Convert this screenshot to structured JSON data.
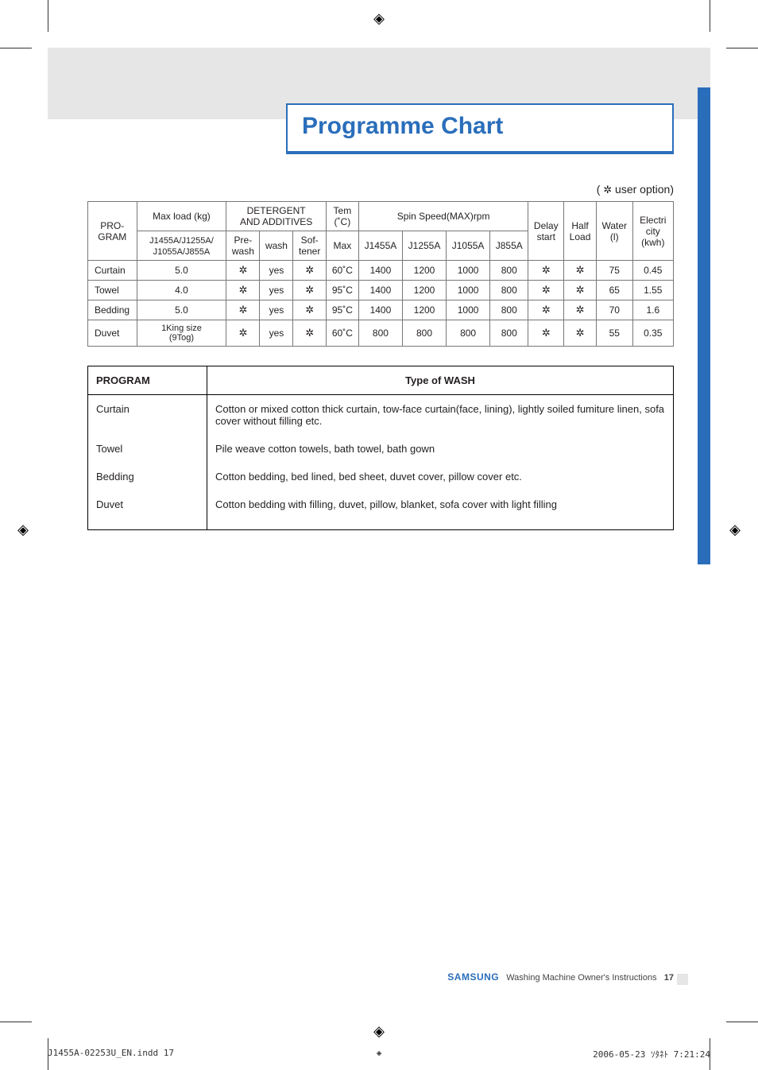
{
  "title": "Programme Chart",
  "legend_prefix": "( ",
  "legend_symbol": "✲",
  "legend_suffix": "    user option)",
  "table1": {
    "header": {
      "program_top": "PRO-",
      "program_bottom": "GRAM",
      "maxload_top": "Max load (kg)",
      "maxload_bottom": "J1455A/J1255A/\nJ1055A/J855A",
      "detergent_top": "DETERGENT\nAND ADDITIVES",
      "det_prewash": "Pre-\nwash",
      "det_wash": "wash",
      "det_softener": "Sof-\ntener",
      "temp_top": "Tem\n(˚C)",
      "temp_bottom": "Max",
      "spin_top": "Spin Speed(MAX)rpm",
      "spin_j1455a": "J1455A",
      "spin_j1255a": "J1255A",
      "spin_j1055a": "J1055A",
      "spin_j855a": "J855A",
      "delay_top": "Delay",
      "delay_bottom": "start",
      "half_top": "Half",
      "half_bottom": "Load",
      "water_top": "Water",
      "water_bottom": "(l)",
      "elec_top": "Electri",
      "elec_bottom": "city\n(kwh)"
    },
    "rows": [
      {
        "program": "Curtain",
        "maxload": "5.0",
        "prewash": "✲",
        "wash": "yes",
        "softener": "✲",
        "temp": "60˚C",
        "j1455a": "1400",
        "j1255a": "1200",
        "j1055a": "1000",
        "j855a": "800",
        "delay": "✲",
        "half": "✲",
        "water": "75",
        "elec": "0.45"
      },
      {
        "program": "Towel",
        "maxload": "4.0",
        "prewash": "✲",
        "wash": "yes",
        "softener": "✲",
        "temp": "95˚C",
        "j1455a": "1400",
        "j1255a": "1200",
        "j1055a": "1000",
        "j855a": "800",
        "delay": "✲",
        "half": "✲",
        "water": "65",
        "elec": "1.55"
      },
      {
        "program": "Bedding",
        "maxload": "5.0",
        "prewash": "✲",
        "wash": "yes",
        "softener": "✲",
        "temp": "95˚C",
        "j1455a": "1400",
        "j1255a": "1200",
        "j1055a": "1000",
        "j855a": "800",
        "delay": "✲",
        "half": "✲",
        "water": "70",
        "elec": "1.6"
      },
      {
        "program": "Duvet",
        "maxload": "1King size\n(9Tog)",
        "prewash": "✲",
        "wash": "yes",
        "softener": "✲",
        "temp": "60˚C",
        "j1455a": "800",
        "j1255a": "800",
        "j1055a": "800",
        "j855a": "800",
        "delay": "✲",
        "half": "✲",
        "water": "55",
        "elec": "0.35"
      }
    ]
  },
  "table2": {
    "header_program": "PROGRAM",
    "header_type": "Type of  WASH",
    "rows": [
      {
        "program": "Curtain",
        "desc": "Cotton or mixed cotton thick curtain, tow-face curtain(face, lining), lightly soiled fumiture linen, sofa cover without filling etc."
      },
      {
        "program": "Towel",
        "desc": "Pile weave cotton towels, bath towel, bath gown"
      },
      {
        "program": "Bedding",
        "desc": "Cotton bedding, bed lined, bed sheet, duvet cover, pillow cover etc."
      },
      {
        "program": "Duvet",
        "desc": "Cotton bedding with filling, duvet, pillow, blanket, sofa cover with light filling"
      }
    ]
  },
  "footer": {
    "brand": "SAMSUNG",
    "text": "Washing Machine Owner's Instructions",
    "page": "17"
  },
  "slug": {
    "left": "J1455A-02253U_EN.indd   17",
    "right": "2006-05-23   ｿﾀﾈﾄ 7:21:24"
  }
}
